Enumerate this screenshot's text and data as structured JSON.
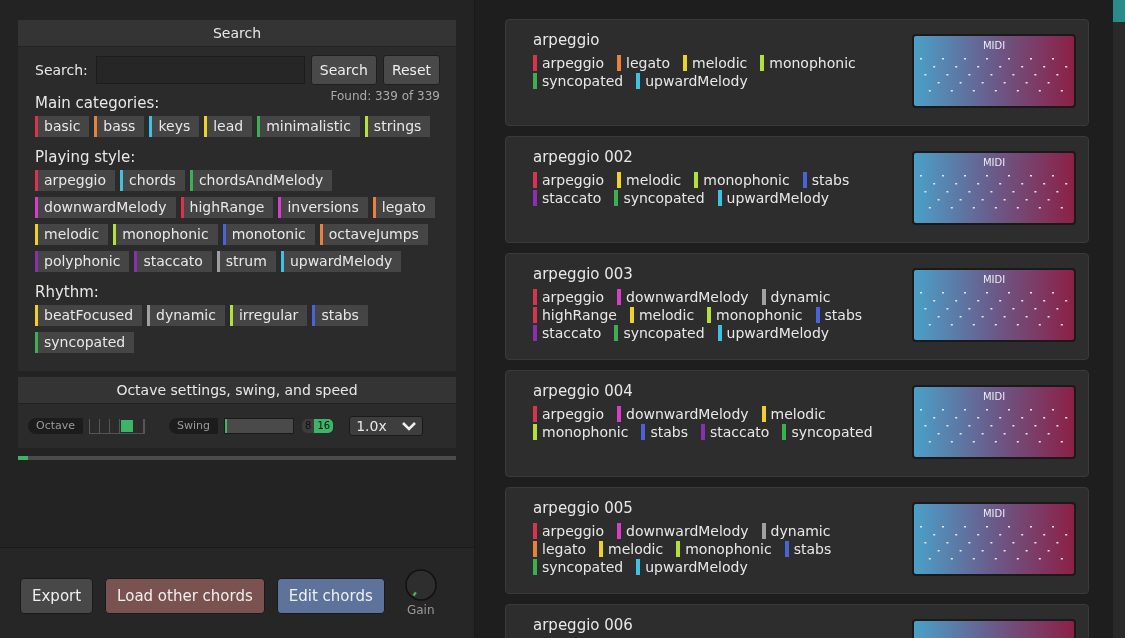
{
  "search": {
    "title": "Search",
    "label": "Search:",
    "buttons": [
      "Search",
      "Reset"
    ],
    "found": "Found: 339 of 339",
    "groups": [
      {
        "label": "Main categories:",
        "tags": [
          {
            "label": "basic",
            "color": "#d9344f"
          },
          {
            "label": "bass",
            "color": "#e8823a"
          },
          {
            "label": "keys",
            "color": "#3ec1e3"
          },
          {
            "label": "lead",
            "color": "#f0d02a"
          },
          {
            "label": "minimalistic",
            "color": "#3cb050"
          },
          {
            "label": "strings",
            "color": "#b4e03a"
          }
        ]
      },
      {
        "label": "Playing style:",
        "tags": [
          {
            "label": "arpeggio",
            "color": "#d9344f"
          },
          {
            "label": "chords",
            "color": "#3ec1e3"
          },
          {
            "label": "chordsAndMelody",
            "color": "#3cb050"
          },
          {
            "label": "downwardMelody",
            "color": "#d63ec9"
          },
          {
            "label": "highRange",
            "color": "#d9344f"
          },
          {
            "label": "inversions",
            "color": "#d63ec9"
          },
          {
            "label": "legato",
            "color": "#e8823a"
          },
          {
            "label": "melodic",
            "color": "#f0d02a"
          },
          {
            "label": "monophonic",
            "color": "#b4e03a"
          },
          {
            "label": "monotonic",
            "color": "#4a63d6"
          },
          {
            "label": "octaveJumps",
            "color": "#e8823a"
          },
          {
            "label": "polyphonic",
            "color": "#8a2fb0"
          },
          {
            "label": "staccato",
            "color": "#8a2fb0"
          },
          {
            "label": "strum",
            "color": "#a0a0a0"
          },
          {
            "label": "upwardMelody",
            "color": "#3ec1e3"
          }
        ]
      },
      {
        "label": "Rhythm:",
        "tags": [
          {
            "label": "beatFocused",
            "color": "#f0d02a"
          },
          {
            "label": "dynamic",
            "color": "#a0a0a0"
          },
          {
            "label": "irregular",
            "color": "#b4e03a"
          },
          {
            "label": "stabs",
            "color": "#4a63d6"
          },
          {
            "label": "syncopated",
            "color": "#3cb050"
          }
        ]
      }
    ]
  },
  "settings": {
    "title": "Octave settings, swing, and speed",
    "octave_label": "Octave",
    "octave_cells": [
      {
        "selected": false
      },
      {
        "selected": false
      },
      {
        "selected": false
      },
      {
        "selected": true
      },
      {
        "selected": false
      }
    ],
    "swing_label": "Swing",
    "swing": {
      "level": 0.02
    },
    "swing_options": [
      {
        "label": "8",
        "selected": false
      },
      {
        "label": "16",
        "selected": true
      }
    ],
    "speed": "1.0x"
  },
  "progress": {
    "level": 0.023
  },
  "footer": {
    "buttons": [
      {
        "label": "Export",
        "kind": "plain"
      },
      {
        "label": "Load other chords",
        "kind": "load"
      },
      {
        "label": "Edit chords",
        "kind": "edit"
      }
    ],
    "gain": {
      "label": "Gain"
    }
  },
  "presets": [
    {
      "name": "arpeggio",
      "badge": "MIDI",
      "tags": [
        {
          "label": "arpeggio",
          "color": "#d9344f"
        },
        {
          "label": "legato",
          "color": "#e8823a"
        },
        {
          "label": "melodic",
          "color": "#f0d02a"
        },
        {
          "label": "monophonic",
          "color": "#b4e03a"
        },
        {
          "label": "syncopated",
          "color": "#3cb050"
        },
        {
          "label": "upwardMelody",
          "color": "#3ec1e3"
        }
      ]
    },
    {
      "name": "arpeggio 002",
      "badge": "MIDI",
      "tags": [
        {
          "label": "arpeggio",
          "color": "#d9344f"
        },
        {
          "label": "melodic",
          "color": "#f0d02a"
        },
        {
          "label": "monophonic",
          "color": "#b4e03a"
        },
        {
          "label": "stabs",
          "color": "#4a63d6"
        },
        {
          "label": "staccato",
          "color": "#8a2fb0"
        },
        {
          "label": "syncopated",
          "color": "#3cb050"
        },
        {
          "label": "upwardMelody",
          "color": "#3ec1e3"
        }
      ]
    },
    {
      "name": "arpeggio 003",
      "badge": "MIDI",
      "tags": [
        {
          "label": "arpeggio",
          "color": "#d9344f"
        },
        {
          "label": "downwardMelody",
          "color": "#d63ec9"
        },
        {
          "label": "dynamic",
          "color": "#a0a0a0"
        },
        {
          "label": "highRange",
          "color": "#d9344f"
        },
        {
          "label": "melodic",
          "color": "#f0d02a"
        },
        {
          "label": "monophonic",
          "color": "#b4e03a"
        },
        {
          "label": "stabs",
          "color": "#4a63d6"
        },
        {
          "label": "staccato",
          "color": "#8a2fb0"
        },
        {
          "label": "syncopated",
          "color": "#3cb050"
        },
        {
          "label": "upwardMelody",
          "color": "#3ec1e3"
        }
      ]
    },
    {
      "name": "arpeggio 004",
      "badge": "MIDI",
      "tags": [
        {
          "label": "arpeggio",
          "color": "#d9344f"
        },
        {
          "label": "downwardMelody",
          "color": "#d63ec9"
        },
        {
          "label": "melodic",
          "color": "#f0d02a"
        },
        {
          "label": "monophonic",
          "color": "#b4e03a"
        },
        {
          "label": "stabs",
          "color": "#4a63d6"
        },
        {
          "label": "staccato",
          "color": "#8a2fb0"
        },
        {
          "label": "syncopated",
          "color": "#3cb050"
        }
      ]
    },
    {
      "name": "arpeggio 005",
      "badge": "MIDI",
      "tags": [
        {
          "label": "arpeggio",
          "color": "#d9344f"
        },
        {
          "label": "downwardMelody",
          "color": "#d63ec9"
        },
        {
          "label": "dynamic",
          "color": "#a0a0a0"
        },
        {
          "label": "legato",
          "color": "#e8823a"
        },
        {
          "label": "melodic",
          "color": "#f0d02a"
        },
        {
          "label": "monophonic",
          "color": "#b4e03a"
        },
        {
          "label": "stabs",
          "color": "#4a63d6"
        },
        {
          "label": "syncopated",
          "color": "#3cb050"
        },
        {
          "label": "upwardMelody",
          "color": "#3ec1e3"
        }
      ]
    },
    {
      "name": "arpeggio 006"
    }
  ]
}
